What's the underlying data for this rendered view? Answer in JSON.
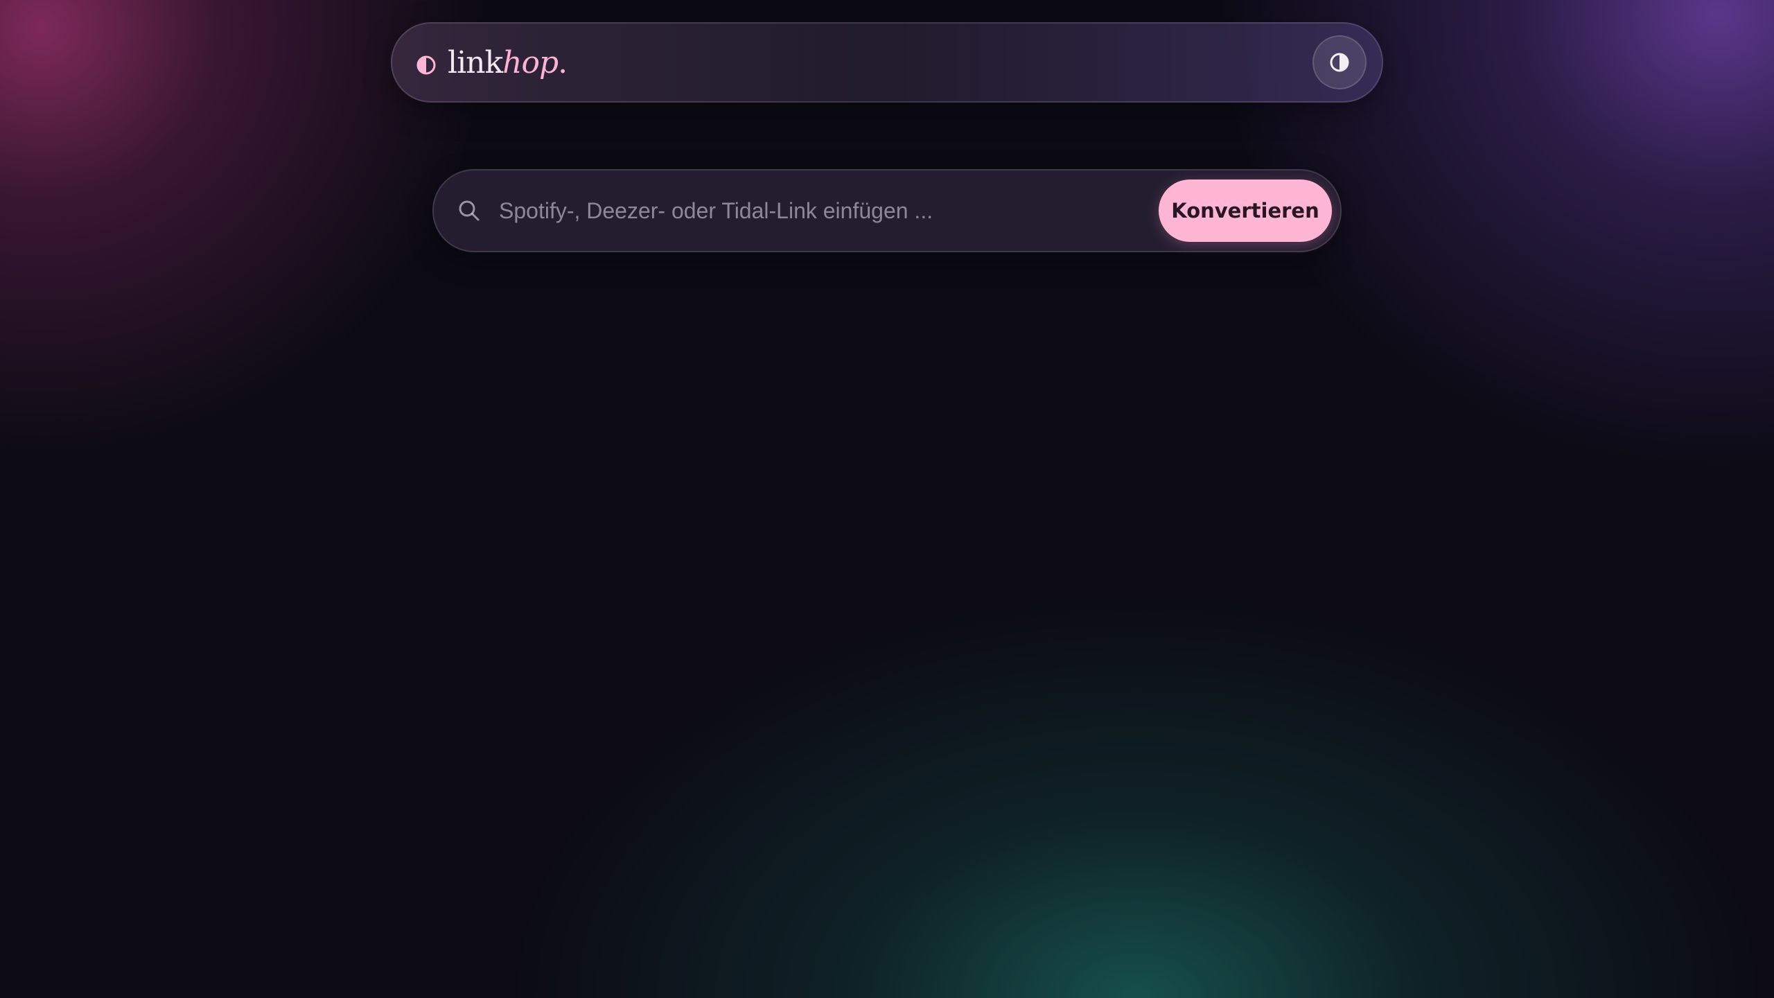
{
  "colors": {
    "background": "#0c0b15",
    "accent": "#ffb6d4",
    "brand_text": "#f3e9f2",
    "glow_pink": "#962f68",
    "glow_purple": "#683e9e",
    "glow_teal": "#185c54"
  },
  "header": {
    "logo_icon": "half-circle-icon",
    "brand_primary": "link",
    "brand_accent": "hop",
    "brand_dot": ".",
    "theme_toggle_icon": "contrast-icon"
  },
  "search": {
    "icon": "search-icon",
    "placeholder": "Spotify-, Deezer- oder Tidal-Link einfügen ...",
    "value": "",
    "button_label": "Konvertieren"
  }
}
